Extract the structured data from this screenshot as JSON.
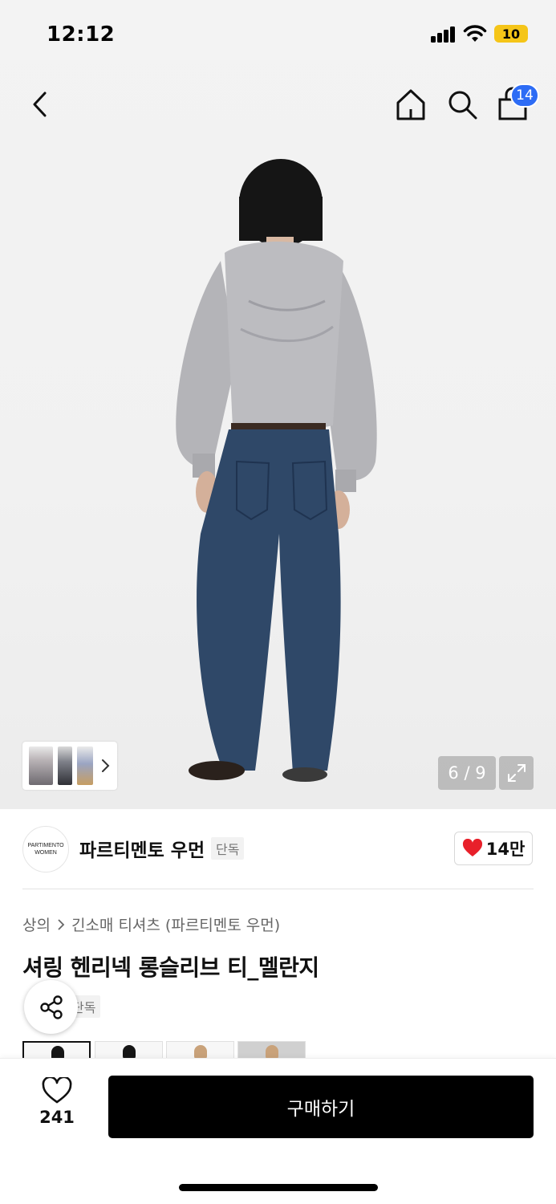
{
  "status": {
    "time": "12:12",
    "battery": "10"
  },
  "nav": {
    "cart_count": "14"
  },
  "gallery": {
    "pager": "6 / 9"
  },
  "brand": {
    "logo_line1": "PARTIMENTO",
    "logo_line2": "WOMEN",
    "name": "파르티멘토 우먼",
    "tag": "단독",
    "likes": "14만"
  },
  "breadcrumb": {
    "category": "상의",
    "sub_category": "긴소매 티셔츠 (파르티멘토 우먼)"
  },
  "product": {
    "title": "셔링 헨리넥 롱슬리브 티_멜란지",
    "tag": "단독"
  },
  "bottom": {
    "wish_count": "241",
    "buy_label": "구매하기"
  },
  "colors": {
    "like_heart": "#e8202a",
    "badge": "#2d6cf5"
  }
}
